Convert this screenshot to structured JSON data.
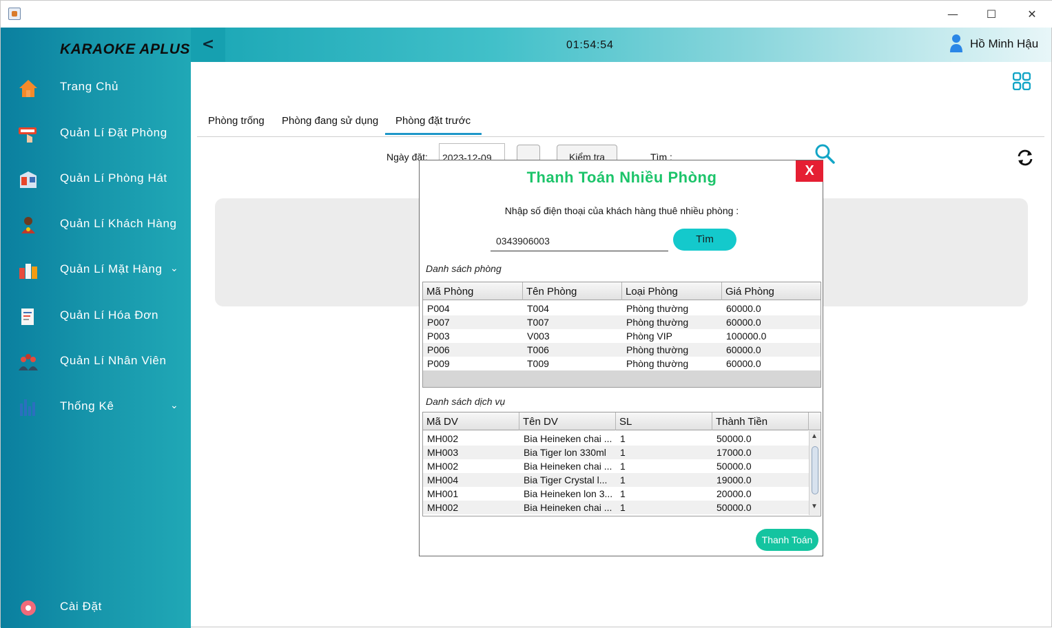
{
  "window": {
    "minimize": "—",
    "maximize": "☐",
    "close": "✕"
  },
  "sidebar": {
    "brand": "KARAOKE APLUS",
    "items": [
      {
        "label": "Trang Chủ",
        "icon": "home-icon"
      },
      {
        "label": "Quản Lí Đặt Phòng",
        "icon": "booking-icon"
      },
      {
        "label": "Quản Lí Phòng Hát",
        "icon": "room-icon"
      },
      {
        "label": "Quản Lí Khách Hàng",
        "icon": "customer-icon"
      },
      {
        "label": "Quản Lí Mặt Hàng",
        "icon": "products-icon",
        "chevron": "⌄"
      },
      {
        "label": "Quản Lí Hóa Đơn",
        "icon": "invoice-icon"
      },
      {
        "label": "Quản Lí Nhân Viên",
        "icon": "staff-icon"
      },
      {
        "label": "Thống Kê",
        "icon": "stats-icon",
        "chevron": "⌄"
      }
    ],
    "settings_label": "Cài Đặt"
  },
  "header": {
    "back": "<",
    "clock": "01:54:54",
    "user": "Hồ Minh Hậu"
  },
  "tabs": [
    "Phòng trống",
    "Phòng đang sử dụng",
    "Phòng đặt trước"
  ],
  "filters": {
    "date_label": "Ngày đặt:",
    "date_value": "2023-12-09",
    "check_label": "Kiểm tra",
    "search_label": "Tìm :"
  },
  "dialog": {
    "title": "Thanh Toán Nhiều Phòng",
    "close": "X",
    "prompt": "Nhập số điện thoại của khách hàng thuê nhiều phòng :",
    "phone": "0343906003",
    "find": "Tìm",
    "rooms_label": "Danh sách phòng",
    "rooms_headers": [
      "Mã Phòng",
      "Tên Phòng",
      "Loại Phòng",
      "Giá Phòng"
    ],
    "rooms": [
      [
        "P004",
        "T004",
        "Phòng thường",
        "60000.0"
      ],
      [
        "P007",
        "T007",
        "Phòng thường",
        "60000.0"
      ],
      [
        "P003",
        "V003",
        "Phòng VIP",
        "100000.0"
      ],
      [
        "P006",
        "T006",
        "Phòng thường",
        "60000.0"
      ],
      [
        "P009",
        "T009",
        "Phòng thường",
        "60000.0"
      ]
    ],
    "services_label": "Danh sách dịch vụ",
    "services_headers": [
      "Mã DV",
      "Tên DV",
      "SL",
      "Thành Tiền"
    ],
    "services": [
      [
        "MH002",
        "Bia Heineken chai ...",
        "1",
        "50000.0"
      ],
      [
        "MH003",
        "Bia Tiger lon 330ml",
        "1",
        "17000.0"
      ],
      [
        "MH002",
        "Bia Heineken chai ...",
        "1",
        "50000.0"
      ],
      [
        "MH004",
        "Bia Tiger Crystal l...",
        "1",
        "19000.0"
      ],
      [
        "MH001",
        "Bia Heineken lon 3...",
        "1",
        "20000.0"
      ],
      [
        "MH002",
        "Bia Heineken chai ...",
        "1",
        "50000.0"
      ]
    ],
    "pay": "Thanh Toán"
  },
  "colors": {
    "accent": "#1cc46a",
    "close": "#e51f33",
    "tab_underline": "#1e97c9"
  }
}
